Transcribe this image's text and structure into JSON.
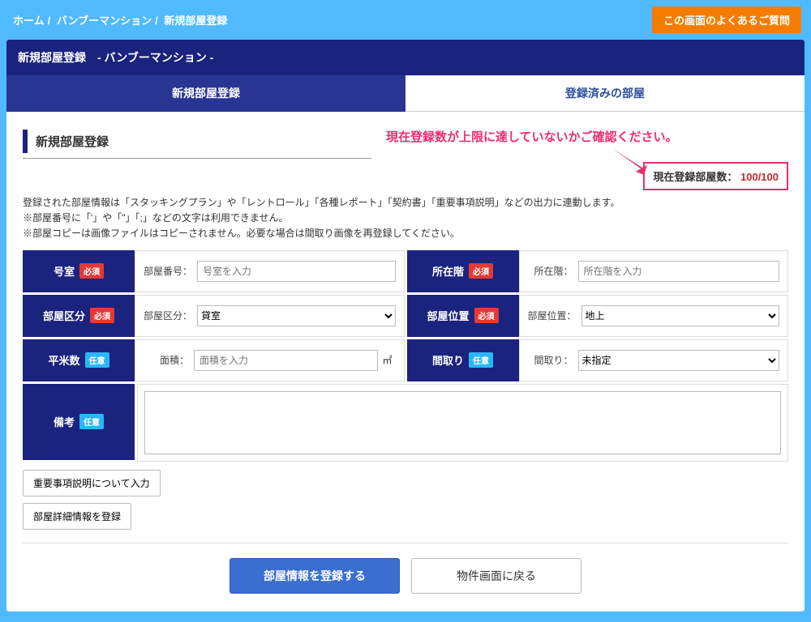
{
  "breadcrumb": {
    "home": "ホーム",
    "building": "バンブーマンション",
    "current": "新規部屋登録"
  },
  "faq_button": "この画面のよくあるご質問",
  "panel_title": "新規部屋登録　- バンブーマンション -",
  "tabs": {
    "new": "新規部屋登録",
    "registered": "登録済みの部屋"
  },
  "section_title": "新規部屋登録",
  "annotation": "現在登録数が上限に達していないかご確認ください。",
  "room_count": {
    "label": "現在登録部屋数：",
    "value": "100/100"
  },
  "notes": {
    "line1": "登録された部屋情報は「スタッキングプラン」や「レントロール」「各種レポート」「契約書」「重要事項説明」などの出力に連動します。",
    "line2": "※部屋番号に「'」や「\"」「;」などの文字は利用できません。",
    "line3": "※部屋コピーは画像ファイルはコピーされません。必要な場合は間取り画像を再登録してください。"
  },
  "badges": {
    "required": "必須",
    "optional": "任意"
  },
  "fields": {
    "room_no": {
      "label": "号室",
      "key": "部屋番号：",
      "placeholder": "号室を入力"
    },
    "floor": {
      "label": "所在階",
      "key": "所在階：",
      "placeholder": "所在階を入力"
    },
    "room_type": {
      "label": "部屋区分",
      "key": "部屋区分：",
      "value": "貸室"
    },
    "position": {
      "label": "部屋位置",
      "key": "部屋位置：",
      "value": "地上"
    },
    "area": {
      "label": "平米数",
      "key": "面積：",
      "placeholder": "面積を入力",
      "unit": "㎡"
    },
    "layout": {
      "label": "間取り",
      "key": "間取り：",
      "value": "未指定"
    },
    "remarks": {
      "label": "備考"
    }
  },
  "extra_buttons": {
    "important": "重要事項説明について入力",
    "detail": "部屋詳細情報を登録"
  },
  "footer": {
    "submit": "部屋情報を登録する",
    "back": "物件画面に戻る"
  }
}
